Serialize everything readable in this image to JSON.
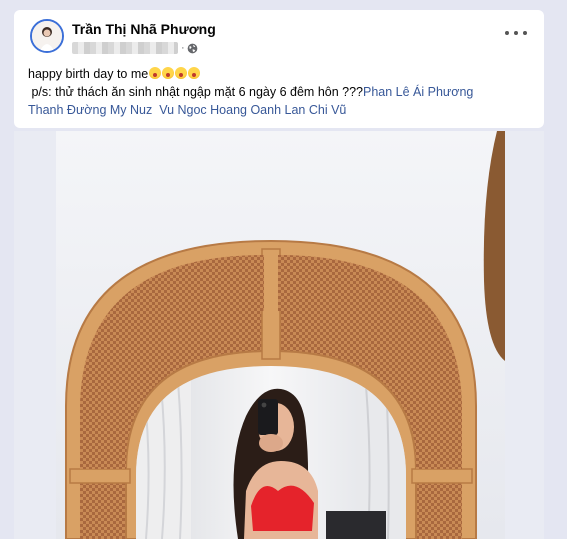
{
  "post": {
    "author": "Trần Thị Nhã Phương",
    "line1": "happy birth day to me",
    "line2_prefix": "p/s: thử thách ăn sinh nhật ngập mặt  6 ngày 6 đêm  hôn ???",
    "mentions": [
      "Phan Lê Ái Phương",
      "Thanh Đường My Nuz",
      "Vu Ngoc Hoang Oanh",
      "Lan Chi Vũ"
    ],
    "emoji_count": 4
  },
  "icons": {
    "more": "more-options-icon",
    "privacy": "globe-icon"
  },
  "colors": {
    "link": "#385898",
    "avatar_ring": "#3b6fd8",
    "rattan_frame": "#d9a165",
    "swimsuit": "#e5232b"
  }
}
